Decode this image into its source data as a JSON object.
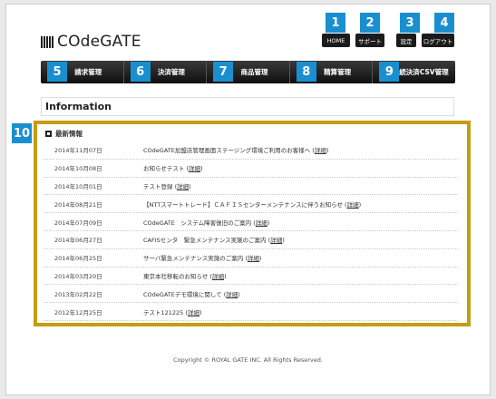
{
  "header": {
    "logo_text": "COdeGATE",
    "topnav": [
      {
        "badge": "1",
        "label": "HOME"
      },
      {
        "badge": "2",
        "label": "サポート"
      },
      {
        "badge": "3",
        "label": "設定"
      },
      {
        "badge": "4",
        "label": "ログアウト"
      }
    ]
  },
  "mainnav": [
    {
      "badge": "5",
      "label": "請求管理"
    },
    {
      "badge": "6",
      "label": "決済管理"
    },
    {
      "badge": "7",
      "label": "商品管理"
    },
    {
      "badge": "8",
      "label": "精算管理"
    },
    {
      "badge": "9",
      "label": "継続決済CSV管理"
    }
  ],
  "info": {
    "title": "Information",
    "badge": "10",
    "section_title": "最新情報",
    "link_label": "詳細",
    "items": [
      {
        "date": "2014年11月07日",
        "text": "COdeGATE加盟店管理画面ステージング環境ご利用のお客様へ"
      },
      {
        "date": "2014年10月08日",
        "text": "お知らせテスト"
      },
      {
        "date": "2014年10月01日",
        "text": "テスト登録"
      },
      {
        "date": "2014年08月21日",
        "text": "【NTTスマートトレード】ＣＡＦＩＳセンターメンテナンスに伴うお知らせ"
      },
      {
        "date": "2014年07月09日",
        "text": "COdeGATE　システム障害復旧のご案内"
      },
      {
        "date": "2014年06月27日",
        "text": "CAFISセンタ　緊急メンテナンス実施のご案内"
      },
      {
        "date": "2014年06月25日",
        "text": "サーバ緊急メンテナンス実施のご案内"
      },
      {
        "date": "2014年03月20日",
        "text": "東京本社移転のお知らせ"
      },
      {
        "date": "2013年02月22日",
        "text": "COdeGATEデモ環境に関して"
      },
      {
        "date": "2012年12月25日",
        "text": "テスト121225"
      }
    ]
  },
  "footer": {
    "copyright": "Copyright © ROYAL GATE INC. All Rights Reserved."
  },
  "colors": {
    "badge": "#1a8fd0",
    "highlight_border": "#c69c12",
    "nav_bg": "#1b1b1b"
  }
}
